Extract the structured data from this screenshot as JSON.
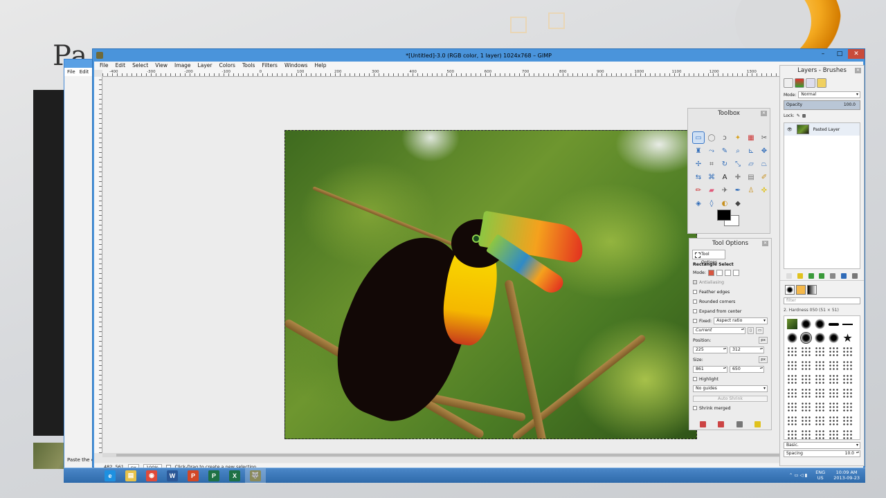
{
  "slide": {
    "title_fragment": "Pa",
    "colors": {
      "accent_orange": "#F3A81E",
      "dark_panel": "#1E1E1E"
    }
  },
  "background_app": {
    "menu": [
      "File",
      "Edit"
    ],
    "status_text": "Paste the co"
  },
  "window": {
    "title": "*[Untitled]-3.0 (RGB color, 1 layer) 1024x768 – GIMP",
    "controls": [
      "–",
      "□",
      "✕"
    ]
  },
  "menu": [
    "File",
    "Edit",
    "Select",
    "View",
    "Image",
    "Layer",
    "Colors",
    "Tools",
    "Filters",
    "Windows",
    "Help"
  ],
  "ruler": {
    "labels": [
      "-400",
      "-300",
      "-200",
      "-100",
      "0",
      "100",
      "200",
      "300",
      "400",
      "500",
      "600",
      "700",
      "800",
      "900",
      "1000",
      "1100",
      "1200",
      "1300"
    ]
  },
  "statusbar": {
    "coords": "482, 561",
    "unit": "px",
    "zoom": "100%",
    "message": "Click-Drag to create a new selection"
  },
  "toolbox": {
    "title": "Toolbox",
    "tools": [
      {
        "name": "rect-select-icon",
        "glyph": "▭",
        "active": true,
        "color": "#3a78c8"
      },
      {
        "name": "ellipse-select-icon",
        "glyph": "◯",
        "color": "#777"
      },
      {
        "name": "free-select-icon",
        "glyph": "ↄ",
        "color": "#555"
      },
      {
        "name": "fuzzy-select-icon",
        "glyph": "✦",
        "color": "#d8a21e"
      },
      {
        "name": "select-by-color-icon",
        "glyph": "▦",
        "color": "#c33"
      },
      {
        "name": "scissors-icon",
        "glyph": "✂",
        "color": "#555"
      },
      {
        "name": "foreground-select-icon",
        "glyph": "♜",
        "color": "#2f6bb8"
      },
      {
        "name": "paths-icon",
        "glyph": "⤳",
        "color": "#2f6bb8"
      },
      {
        "name": "color-picker-icon",
        "glyph": "✎",
        "color": "#2f6bb8"
      },
      {
        "name": "zoom-icon",
        "glyph": "⌕",
        "color": "#2f6bb8"
      },
      {
        "name": "measure-icon",
        "glyph": "⊾",
        "color": "#2f6bb8"
      },
      {
        "name": "move-icon",
        "glyph": "✥",
        "color": "#2f6bb8"
      },
      {
        "name": "align-icon",
        "glyph": "✢",
        "color": "#2f6bb8"
      },
      {
        "name": "crop-icon",
        "glyph": "⌗",
        "color": "#555"
      },
      {
        "name": "rotate-icon",
        "glyph": "↻",
        "color": "#2f6bb8"
      },
      {
        "name": "scale-icon",
        "glyph": "⤡",
        "color": "#2f6bb8"
      },
      {
        "name": "shear-icon",
        "glyph": "▱",
        "color": "#2f6bb8"
      },
      {
        "name": "perspective-icon",
        "glyph": "⏢",
        "color": "#2f6bb8"
      },
      {
        "name": "flip-icon",
        "glyph": "⇆",
        "color": "#2f6bb8"
      },
      {
        "name": "cage-icon",
        "glyph": "⌘",
        "color": "#2f6bb8"
      },
      {
        "name": "text-icon",
        "glyph": "A",
        "color": "#222"
      },
      {
        "name": "heal-icon",
        "glyph": "✚",
        "color": "#888"
      },
      {
        "name": "blend-icon",
        "glyph": "▤",
        "color": "#777"
      },
      {
        "name": "paintbrush-icon",
        "glyph": "✐",
        "color": "#c8901e"
      },
      {
        "name": "pencil-icon",
        "glyph": "✏",
        "color": "#c33"
      },
      {
        "name": "eraser-icon",
        "glyph": "▰",
        "color": "#e05a7a"
      },
      {
        "name": "airbrush-icon",
        "glyph": "✈",
        "color": "#555"
      },
      {
        "name": "ink-icon",
        "glyph": "✒",
        "color": "#2f6bb8"
      },
      {
        "name": "clone-icon",
        "glyph": "♙",
        "color": "#c8901e"
      },
      {
        "name": "perspective-clone-icon",
        "glyph": "✜",
        "color": "#e0c21e"
      },
      {
        "name": "blur-icon",
        "glyph": "◈",
        "color": "#2f6bb8"
      },
      {
        "name": "smudge-icon",
        "glyph": "◊",
        "color": "#2f6bb8"
      },
      {
        "name": "dodge-burn-icon",
        "glyph": "◐",
        "color": "#c8901e"
      },
      {
        "name": "bucket-fill-icon",
        "glyph": "◆",
        "color": "#444"
      }
    ],
    "foreground_color": "#000000",
    "background_color": "#FFFFFF"
  },
  "tool_options": {
    "title": "Tool Options",
    "tab_label": "Tool Options",
    "tool_name": "Rectangle Select",
    "mode_label": "Mode:",
    "antialiasing": "Antialiasing",
    "feather_edges": "Feather edges",
    "rounded_corners": "Rounded corners",
    "expand_from_center": "Expand from center",
    "fixed_label": "Fixed:",
    "fixed_value": "Aspect ratio",
    "current_value": "Current",
    "position_label": "Position:",
    "position_x": "225",
    "position_y": "312",
    "size_label": "Size:",
    "size_w": "861",
    "size_h": "650",
    "unit": "px",
    "highlight": "Highlight",
    "guides": "No guides",
    "auto_shrink": "Auto Shrink",
    "shrink_merged": "Shrink merged"
  },
  "layers": {
    "title": "Layers - Brushes",
    "mode_label": "Mode:",
    "mode_value": "Normal",
    "opacity_label": "Opacity",
    "opacity_value": "100.0",
    "lock_label": "Lock:",
    "layer_name": "Pasted Layer",
    "brush_filter_placeholder": "filter",
    "brush_name": "2. Hardness 050 (51 × 51)",
    "brush_set": "Basic.",
    "spacing_label": "Spacing",
    "spacing_value": "10.0"
  },
  "taskbar": {
    "items": [
      {
        "name": "ie-icon",
        "glyph": "e",
        "color": "#1e90e0"
      },
      {
        "name": "file-explorer-icon",
        "glyph": "▤",
        "color": "#e8c24a"
      },
      {
        "name": "chrome-icon",
        "glyph": "◉",
        "color": "#e04a3a"
      },
      {
        "name": "word-icon",
        "glyph": "W",
        "color": "#2b5797"
      },
      {
        "name": "powerpoint-icon",
        "glyph": "P",
        "color": "#d24726"
      },
      {
        "name": "publisher-icon",
        "glyph": "P",
        "color": "#1e7145"
      },
      {
        "name": "excel-icon",
        "glyph": "X",
        "color": "#1e7145"
      },
      {
        "name": "gimp-icon",
        "glyph": "🐺",
        "color": "#8a8a5a"
      }
    ],
    "language": "ENG",
    "region": "US",
    "time": "10:09 AM",
    "date": "2013-09-23"
  }
}
